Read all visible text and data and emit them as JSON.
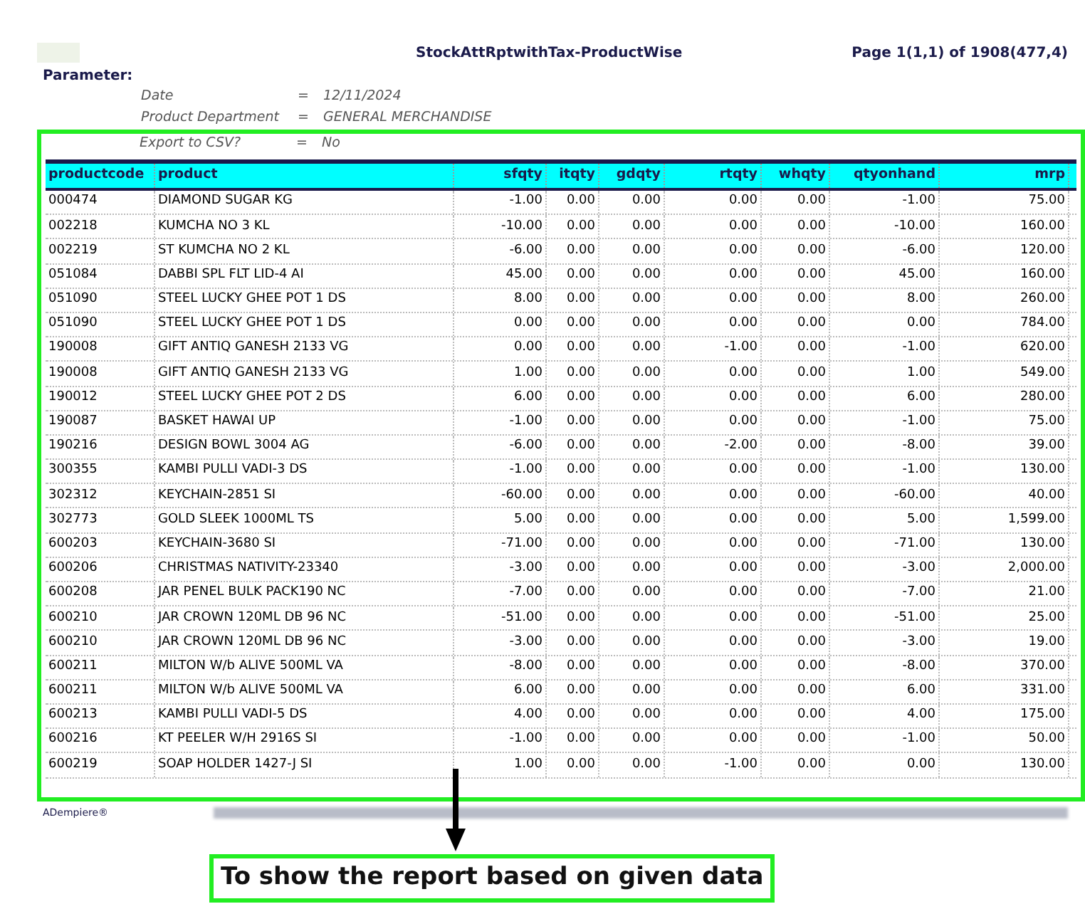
{
  "report": {
    "title": "StockAttRptwithTax-ProductWise",
    "page_info": "Page 1(1,1) of 1908(477,4)",
    "parameter_heading": "Parameter:",
    "parameters": [
      {
        "label": "Date",
        "sign": "=",
        "value": "12/11/2024"
      },
      {
        "label": "Product Department",
        "sign": "=",
        "value": "GENERAL MERCHANDISE"
      },
      {
        "label": "Export to CSV?",
        "sign": "=",
        "value": "No"
      }
    ]
  },
  "table": {
    "columns": [
      "productcode",
      "product",
      "sfqty",
      "itqty",
      "gdqty",
      "rtqty",
      "whqty",
      "qtyonhand",
      "mrp"
    ],
    "rows": [
      [
        "000474",
        "DIAMOND SUGAR KG",
        "-1.00",
        "0.00",
        "0.00",
        "0.00",
        "0.00",
        "-1.00",
        "75.00"
      ],
      [
        "002218",
        "KUMCHA NO 3 KL",
        "-10.00",
        "0.00",
        "0.00",
        "0.00",
        "0.00",
        "-10.00",
        "160.00"
      ],
      [
        "002219",
        "ST KUMCHA NO 2 KL",
        "-6.00",
        "0.00",
        "0.00",
        "0.00",
        "0.00",
        "-6.00",
        "120.00"
      ],
      [
        "051084",
        "DABBI SPL FLT LID-4 AI",
        "45.00",
        "0.00",
        "0.00",
        "0.00",
        "0.00",
        "45.00",
        "160.00"
      ],
      [
        "051090",
        "STEEL LUCKY GHEE POT 1 DS",
        "8.00",
        "0.00",
        "0.00",
        "0.00",
        "0.00",
        "8.00",
        "260.00"
      ],
      [
        "051090",
        "STEEL LUCKY GHEE POT 1 DS",
        "0.00",
        "0.00",
        "0.00",
        "0.00",
        "0.00",
        "0.00",
        "784.00"
      ],
      [
        "190008",
        "GIFT ANTIQ GANESH 2133 VG",
        "0.00",
        "0.00",
        "0.00",
        "-1.00",
        "0.00",
        "-1.00",
        "620.00"
      ],
      [
        "190008",
        "GIFT ANTIQ GANESH 2133 VG",
        "1.00",
        "0.00",
        "0.00",
        "0.00",
        "0.00",
        "1.00",
        "549.00"
      ],
      [
        "190012",
        "STEEL LUCKY GHEE POT 2 DS",
        "6.00",
        "0.00",
        "0.00",
        "0.00",
        "0.00",
        "6.00",
        "280.00"
      ],
      [
        "190087",
        "BASKET HAWAI UP",
        "-1.00",
        "0.00",
        "0.00",
        "0.00",
        "0.00",
        "-1.00",
        "75.00"
      ],
      [
        "190216",
        "DESIGN BOWL 3004 AG",
        "-6.00",
        "0.00",
        "0.00",
        "-2.00",
        "0.00",
        "-8.00",
        "39.00"
      ],
      [
        "300355",
        "KAMBI PULLI VADI-3 DS",
        "-1.00",
        "0.00",
        "0.00",
        "0.00",
        "0.00",
        "-1.00",
        "130.00"
      ],
      [
        "302312",
        "KEYCHAIN-2851 SI",
        "-60.00",
        "0.00",
        "0.00",
        "0.00",
        "0.00",
        "-60.00",
        "40.00"
      ],
      [
        "302773",
        "GOLD SLEEK 1000ML TS",
        "5.00",
        "0.00",
        "0.00",
        "0.00",
        "0.00",
        "5.00",
        "1,599.00"
      ],
      [
        "600203",
        "KEYCHAIN-3680 SI",
        "-71.00",
        "0.00",
        "0.00",
        "0.00",
        "0.00",
        "-71.00",
        "130.00"
      ],
      [
        "600206",
        "CHRISTMAS NATIVITY-23340",
        "-3.00",
        "0.00",
        "0.00",
        "0.00",
        "0.00",
        "-3.00",
        "2,000.00"
      ],
      [
        "600208",
        "JAR PENEL BULK PACK190 NC",
        "-7.00",
        "0.00",
        "0.00",
        "0.00",
        "0.00",
        "-7.00",
        "21.00"
      ],
      [
        "600210",
        "JAR CROWN 120ML DB 96 NC",
        "-51.00",
        "0.00",
        "0.00",
        "0.00",
        "0.00",
        "-51.00",
        "25.00"
      ],
      [
        "600210",
        "JAR CROWN 120ML DB 96 NC",
        "-3.00",
        "0.00",
        "0.00",
        "0.00",
        "0.00",
        "-3.00",
        "19.00"
      ],
      [
        "600211",
        "MILTON W/b ALIVE 500ML VA",
        "-8.00",
        "0.00",
        "0.00",
        "0.00",
        "0.00",
        "-8.00",
        "370.00"
      ],
      [
        "600211",
        "MILTON W/b ALIVE 500ML VA",
        "6.00",
        "0.00",
        "0.00",
        "0.00",
        "0.00",
        "6.00",
        "331.00"
      ],
      [
        "600213",
        "KAMBI PULLI VADI-5 DS",
        "4.00",
        "0.00",
        "0.00",
        "0.00",
        "0.00",
        "4.00",
        "175.00"
      ],
      [
        "600216",
        "KT PEELER W/H 2916S SI",
        "-1.00",
        "0.00",
        "0.00",
        "0.00",
        "0.00",
        "-1.00",
        "50.00"
      ],
      [
        "600219",
        "SOAP HOLDER 1427-J SI",
        "1.00",
        "0.00",
        "0.00",
        "-1.00",
        "0.00",
        "0.00",
        "130.00"
      ]
    ]
  },
  "footer": {
    "brand": "ADempiere®"
  },
  "annotation": {
    "caption": "To show the report based on given data"
  }
}
